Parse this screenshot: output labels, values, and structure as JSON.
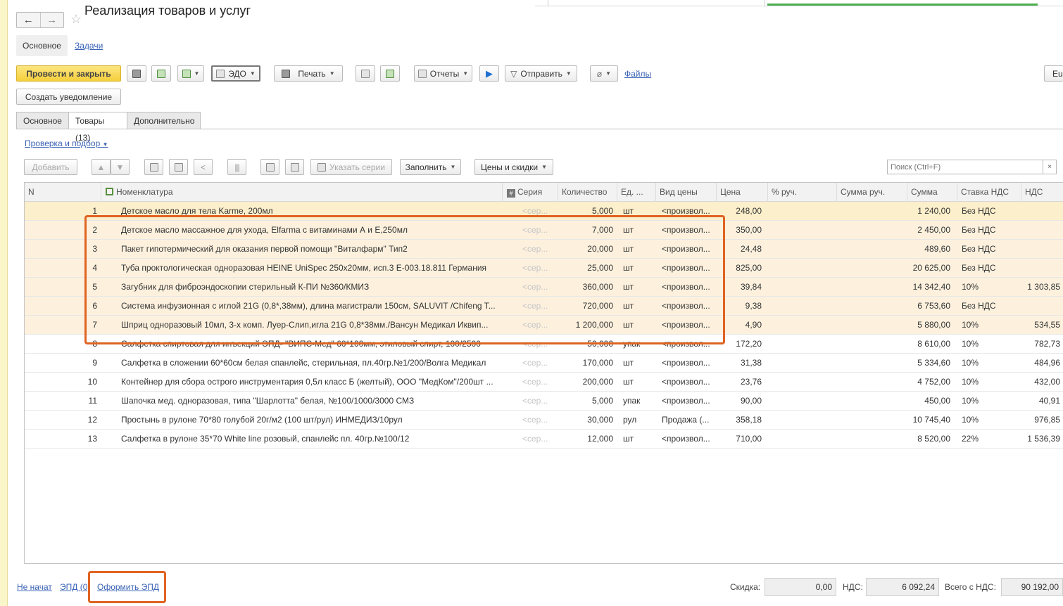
{
  "window": {
    "title": "Реализация товаров и услуг"
  },
  "nav": {
    "back": "←",
    "forward": "→",
    "star": "☆"
  },
  "subtabs": {
    "main": "Основное",
    "tasks": "Задачи"
  },
  "toolbar": {
    "post_close": "Провести и закрыть",
    "edo": "ЭДО",
    "print": "Печать",
    "reports": "Отчеты",
    "send": "Отправить",
    "files": "Файлы",
    "extra": "Eu",
    "create_notice": "Создать уведомление"
  },
  "tabs": {
    "main": "Основное",
    "goods": "Товары (13)",
    "extra": "Дополнительно"
  },
  "goods_toolbar": {
    "check_link": "Проверка и подбор",
    "add": "Добавить",
    "series": "Указать серии",
    "fill": "Заполнить",
    "prices": "Цены и скидки",
    "search_placeholder": "Поиск (Ctrl+F)",
    "clear": "×"
  },
  "table": {
    "columns": {
      "n": "N",
      "nomenclature": "Номенклатура",
      "series": "Серия",
      "qty": "Количество",
      "unit": "Ед. ...",
      "price_type": "Вид цены",
      "price": "Цена",
      "manual_pct": "% руч.",
      "manual_sum": "Сумма руч.",
      "sum": "Сумма",
      "vat_rate": "Ставка НДС",
      "vat": "НДС"
    },
    "rows": [
      {
        "n": "1",
        "name": "Детское масло для тела Karme, 200мл",
        "series": "<сер...",
        "qty": "5,000",
        "unit": "шт",
        "price_type": "<произвол...",
        "price": "248,00",
        "sum": "1 240,00",
        "vat_rate": "Без НДС",
        "vat": ""
      },
      {
        "n": "2",
        "name": "Детское масло массажное для ухода, Elfarma с витаминами А и Е,250мл",
        "series": "<сер...",
        "qty": "7,000",
        "unit": "шт",
        "price_type": "<произвол...",
        "price": "350,00",
        "sum": "2 450,00",
        "vat_rate": "Без НДС",
        "vat": ""
      },
      {
        "n": "3",
        "name": "Пакет гипотермический для оказания первой помощи \"Виталфарм\" Тип2",
        "series": "<сер...",
        "qty": "20,000",
        "unit": "шт",
        "price_type": "<произвол...",
        "price": "24,48",
        "sum": "489,60",
        "vat_rate": "Без НДС",
        "vat": ""
      },
      {
        "n": "4",
        "name": "Туба проктологическая одноразовая HEINE UniSpec 250х20мм, исп.3 Е-003.18.811 Германия",
        "series": "<сер...",
        "qty": "25,000",
        "unit": "шт",
        "price_type": "<произвол...",
        "price": "825,00",
        "sum": "20 625,00",
        "vat_rate": "Без НДС",
        "vat": ""
      },
      {
        "n": "5",
        "name": "Загубник для фиброэндоскопии стерильный К-ПИ №360/КМИЗ",
        "series": "<сер...",
        "qty": "360,000",
        "unit": "шт",
        "price_type": "<произвол...",
        "price": "39,84",
        "sum": "14 342,40",
        "vat_rate": "10%",
        "vat": "1 303,85"
      },
      {
        "n": "6",
        "name": "Система инфузионная с иглой 21G (0,8*,38мм), длина магистрали 150см, SALUVIT /Chifeng T...",
        "series": "<сер...",
        "qty": "720,000",
        "unit": "шт",
        "price_type": "<произвол...",
        "price": "9,38",
        "sum": "6 753,60",
        "vat_rate": "Без НДС",
        "vat": ""
      },
      {
        "n": "7",
        "name": "Шприц одноразовый 10мл, 3-х комп. Луер-Слип,игла 21G 0,8*38мм./Вансун Медикал Иквип...",
        "series": "<сер...",
        "qty": "1 200,000",
        "unit": "шт",
        "price_type": "<произвол...",
        "price": "4,90",
        "sum": "5 880,00",
        "vat_rate": "10%",
        "vat": "534,55"
      },
      {
        "n": "8",
        "name": "Салфетка спиртовая для инъекций ЭПД- \"ВИПС-Мед\" 60*100мм, этиловый спирт, 100/2500",
        "series": "<сер...",
        "qty": "50,000",
        "unit": "упак",
        "price_type": "<произвол...",
        "price": "172,20",
        "sum": "8 610,00",
        "vat_rate": "10%",
        "vat": "782,73"
      },
      {
        "n": "9",
        "name": "Салфетка в сложении 60*60см белая спанлейс, стерильная, пл.40гр.№1/200/Волга Медикал",
        "series": "<сер...",
        "qty": "170,000",
        "unit": "шт",
        "price_type": "<произвол...",
        "price": "31,38",
        "sum": "5 334,60",
        "vat_rate": "10%",
        "vat": "484,96"
      },
      {
        "n": "10",
        "name": "Контейнер для сбора острого инструментария 0,5л класс Б (желтый), ООО \"МедКом\"/200шт ...",
        "series": "<сер...",
        "qty": "200,000",
        "unit": "шт",
        "price_type": "<произвол...",
        "price": "23,76",
        "sum": "4 752,00",
        "vat_rate": "10%",
        "vat": "432,00"
      },
      {
        "n": "11",
        "name": "Шапочка мед. одноразовая, типа \"Шарлотта\" белая, №100/1000/3000 СМЗ",
        "series": "<сер...",
        "qty": "5,000",
        "unit": "упак",
        "price_type": "<произвол...",
        "price": "90,00",
        "sum": "450,00",
        "vat_rate": "10%",
        "vat": "40,91"
      },
      {
        "n": "12",
        "name": "Простынь в рулоне 70*80  голубой 20г/м2 (100 шт/рул) ИНМЕДИЗ/10рул",
        "series": "<сер...",
        "qty": "30,000",
        "unit": "рул",
        "price_type": "Продажа (...",
        "price": "358,18",
        "sum": "10 745,40",
        "vat_rate": "10%",
        "vat": "976,85"
      },
      {
        "n": "13",
        "name": "Салфетка в рулоне 35*70 White line розовый, спанлейс пл. 40гр.№100/12",
        "series": "<сер...",
        "qty": "12,000",
        "unit": "шт",
        "price_type": "<произвол...",
        "price": "710,00",
        "sum": "8 520,00",
        "vat_rate": "22%",
        "vat": "1 536,39"
      }
    ]
  },
  "footer": {
    "status_link": "Не начат",
    "epd_link": "ЭПД (0)",
    "issue_epd": "Оформить ЭПД",
    "discount_label": "Скидка:",
    "discount_value": "0,00",
    "vat_label": "НДС:",
    "vat_value": "6 092,24",
    "total_label": "Всего с НДС:",
    "total_value": "90 192,00"
  },
  "colors": {
    "accent_yellow": "#f5cf3b",
    "highlight_orange": "#e06322",
    "link_blue": "#3a63b5"
  }
}
